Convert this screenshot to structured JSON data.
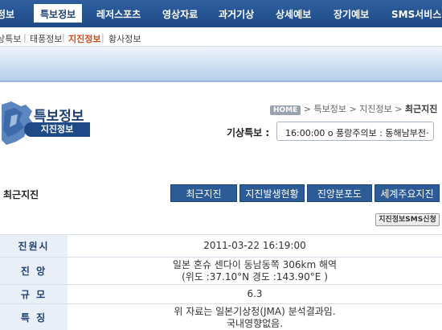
{
  "topnav": {
    "items": [
      "정보",
      "특보정보",
      "레저스포츠",
      "영상자료",
      "과거기상",
      "상세예보",
      "장기예보",
      "SMS서비스"
    ],
    "active_index": 1
  },
  "subnav": {
    "items": [
      "상특보",
      "태풍정보",
      "지진정보",
      "황사정보"
    ],
    "active_index": 2
  },
  "page": {
    "title": "특보정보",
    "subtitle": "지진정보"
  },
  "breadcrumb": {
    "home": "HOME",
    "items": [
      "특보정보",
      "지진정보",
      "최근지진"
    ]
  },
  "alert": {
    "label": "기상특보 :",
    "text": "16:00:00 o 풍랑주의보 : 동해남부전·"
  },
  "section": {
    "title": "최근지진",
    "tabs": [
      "최근지진",
      "지진발생현황",
      "진앙분포도",
      "세계주요지진"
    ],
    "sms_button": "지진정보SMS신청"
  },
  "table": {
    "rows": [
      {
        "label": "진원시",
        "value": [
          "2011-03-22 16:19:00"
        ]
      },
      {
        "label": "진 앙",
        "value": [
          "일본 혼슈 센다이 동남동쪽 306km 해역",
          "(위도 :37.10°N 경도 :143.90°E )"
        ]
      },
      {
        "label": "규 모",
        "value": [
          "6.3"
        ]
      },
      {
        "label": "특 징",
        "value": [
          "위 자료는 일본기상청(JMA) 분석결과임.",
          "국내영향없음."
        ]
      }
    ]
  },
  "colors": {
    "nav_blue": "#1e4a86",
    "accent_orange": "#d14a1b",
    "table_header_bg": "#e9eff7"
  }
}
